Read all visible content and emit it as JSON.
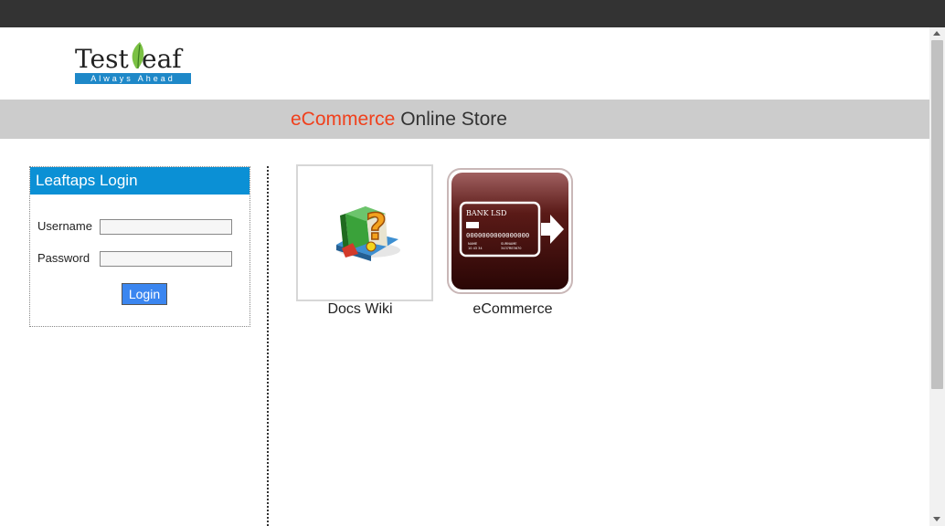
{
  "brand": {
    "logo_text": "TestLeaf",
    "logo_tagline": "Always Ahead"
  },
  "banner": {
    "accent_word": "eCommerce",
    "rest": " Online Store",
    "accent_color": "#f0401c"
  },
  "login": {
    "heading": "Leaftaps Login",
    "username_label": "Username",
    "password_label": "Password",
    "username_value": "",
    "password_value": "",
    "button_label": "Login"
  },
  "apps": [
    {
      "label": "Docs Wiki",
      "icon": "book-question-icon"
    },
    {
      "label": "eCommerce",
      "icon": "bank-card-icon",
      "card_bank": "BANK LSD",
      "card_number": "0000000000000000",
      "card_field_1": "NAME",
      "card_field_2": "SURNAME",
      "card_code_1": "10 43 34",
      "card_code_2": "3437RE3670"
    }
  ],
  "colors": {
    "topbar": "#333333",
    "banner_bg": "#cccccc",
    "login_header": "#0b90d5",
    "button": "#3b86f0",
    "ecommerce_tile": "#5a1a17"
  }
}
